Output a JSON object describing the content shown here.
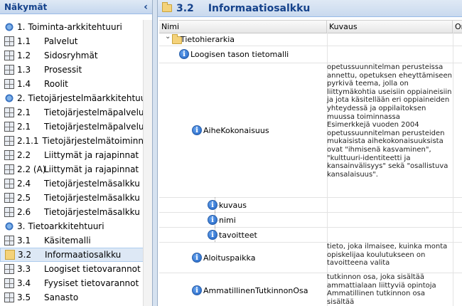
{
  "sidebar": {
    "title": "Näkymät",
    "collapse_icon": "chevron-left-icon",
    "items": [
      {
        "num": "1.",
        "label": "Toiminta-arkkitehtuuri",
        "icon": "gear-group-icon",
        "level": 0
      },
      {
        "num": "1.1",
        "label": "Palvelut",
        "icon": "grid-icon",
        "level": 1
      },
      {
        "num": "1.2",
        "label": "Sidosryhmät",
        "icon": "grid-icon",
        "level": 1
      },
      {
        "num": "1.3",
        "label": "Prosessit",
        "icon": "grid-icon",
        "level": 1
      },
      {
        "num": "1.4",
        "label": "Roolit",
        "icon": "grid-icon",
        "level": 1
      },
      {
        "num": "2.",
        "label": "Tietojärjestelmäarkkitehtuuri",
        "icon": "gear-group-icon",
        "level": 0
      },
      {
        "num": "2.1",
        "label": "Tietojärjestelmäpalvelut",
        "icon": "grid-icon",
        "level": 1
      },
      {
        "num": "2.1",
        "label": "Tietojärjestelmäpalvelut",
        "icon": "grid-icon",
        "level": 1
      },
      {
        "num": "2.1.1",
        "label": "Tietojärjestelmätoiminnot",
        "icon": "grid-icon",
        "level": 1
      },
      {
        "num": "2.2",
        "label": "Liittymät ja rajapinnat",
        "icon": "grid-icon",
        "level": 1
      },
      {
        "num": "2.2 (A)",
        "label": "Liittymät ja rajapinnat",
        "icon": "grid-icon",
        "level": 1
      },
      {
        "num": "2.4",
        "label": "Tietojärjestelmäsalkku",
        "icon": "grid-icon",
        "level": 1
      },
      {
        "num": "2.5",
        "label": "Tietojärjestelmäsalkku",
        "icon": "grid-icon",
        "level": 1
      },
      {
        "num": "2.6",
        "label": "Tietojärjestelmäsalkku",
        "icon": "grid-icon",
        "level": 1
      },
      {
        "num": "3.",
        "label": "Tietoarkkitehtuuri",
        "icon": "gear-group-icon",
        "level": 0
      },
      {
        "num": "3.1",
        "label": "Käsitemalli",
        "icon": "grid-icon",
        "level": 1
      },
      {
        "num": "3.2",
        "label": "Informaatiosalkku",
        "icon": "folder-info-icon",
        "level": 1,
        "selected": true
      },
      {
        "num": "3.3",
        "label": "Loogiset tietovarannot",
        "icon": "grid-icon",
        "level": 1
      },
      {
        "num": "3.4",
        "label": "Fyysiset tietovarannot",
        "icon": "grid-icon",
        "level": 1
      },
      {
        "num": "3.5",
        "label": "Sanasto",
        "icon": "grid-icon",
        "level": 1
      }
    ]
  },
  "main": {
    "num": "3.2",
    "title": "Informaatiosalkku",
    "columns": [
      "Nimi",
      "Kuvaus",
      "Om"
    ],
    "rows": [
      {
        "name": "Tietohierarkia",
        "type": "folder",
        "desc": ""
      },
      {
        "name": "Loogisen tason tietomalli",
        "type": "info",
        "desc": ""
      },
      {
        "name": "AiheKokonaisuus",
        "type": "info",
        "desc": "opetussuunnitelman perusteissa annettu, opetuksen eheyttämiseen pyrkivä teema, jolla on liittymäkohtia useisiin oppiaineisiin ja jota käsitellään eri oppiaineiden yhteydessä ja oppilaitoksen muussa toiminnassa\nEsimerkkejä vuoden 2004 opetussuunnitelman perusteiden mukaisista aihekokonaisuuksista ovat \"ihmisenä kasvaminen\", \"kulttuuri-identiteetti ja kansainvälisyys\" sekä \"osallistuva kansalaisuus\"."
      },
      {
        "name": "kuvaus",
        "type": "info",
        "desc": ""
      },
      {
        "name": "nimi",
        "type": "info",
        "desc": ""
      },
      {
        "name": "tavoitteet",
        "type": "info",
        "desc": ""
      },
      {
        "name": "Aloituspaikka",
        "type": "info",
        "desc": "tieto, joka ilmaisee, kuinka monta opiskelijaa koulutukseen on tavoitteena valita"
      },
      {
        "name": "AmmatillinenTutkinnonOsa",
        "type": "info",
        "desc": "tutkinnon osa, joka sisältää ammattialaan liittyviä opintoja\nAmmatillinen tutkinnon osa sisältää"
      }
    ]
  }
}
